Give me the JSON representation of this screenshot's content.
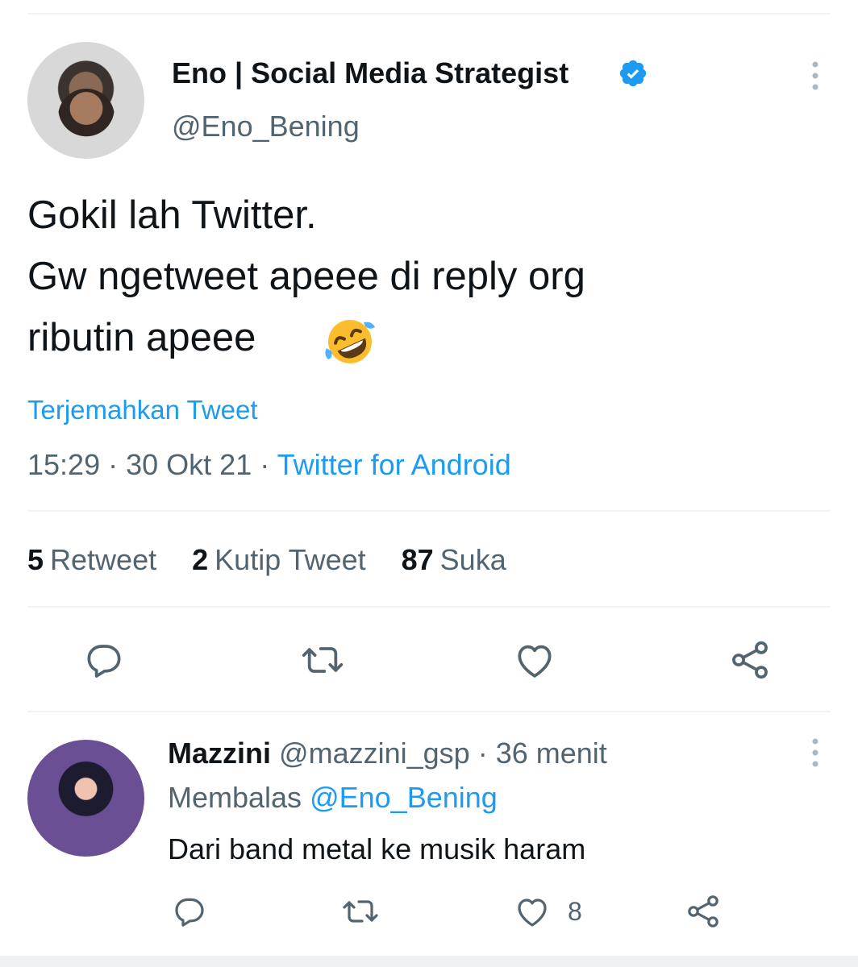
{
  "tweet": {
    "author_name": "Eno | Social Media Strategist",
    "handle": "@Eno_Bening",
    "text_lines": [
      "Gokil lah Twitter.",
      "Gw ngetweet apeee di reply org",
      "ributin apeee"
    ],
    "emoji": "rolling-on-the-floor-laughing",
    "translate_label": "Terjemahkan Tweet",
    "time": "15:29",
    "date": "30 Okt 21",
    "source": "Twitter for Android",
    "separator": "·",
    "retweets": "5",
    "retweets_label": "Retweet",
    "quotes": "2",
    "quotes_label": "Kutip Tweet",
    "likes": "87",
    "likes_label": "Suka"
  },
  "reply": {
    "author_name": "Mazzini",
    "handle": "@mazzini_gsp",
    "age": "36 menit",
    "replying_to_label": "Membalas",
    "replying_to_handle": "@Eno_Bening",
    "text": "Dari band metal ke musik haram",
    "like_count": "8"
  },
  "colors": {
    "accent": "#1d9bf0",
    "text": "#0f1419",
    "muted": "#536471",
    "divider": "#eff3f4"
  }
}
